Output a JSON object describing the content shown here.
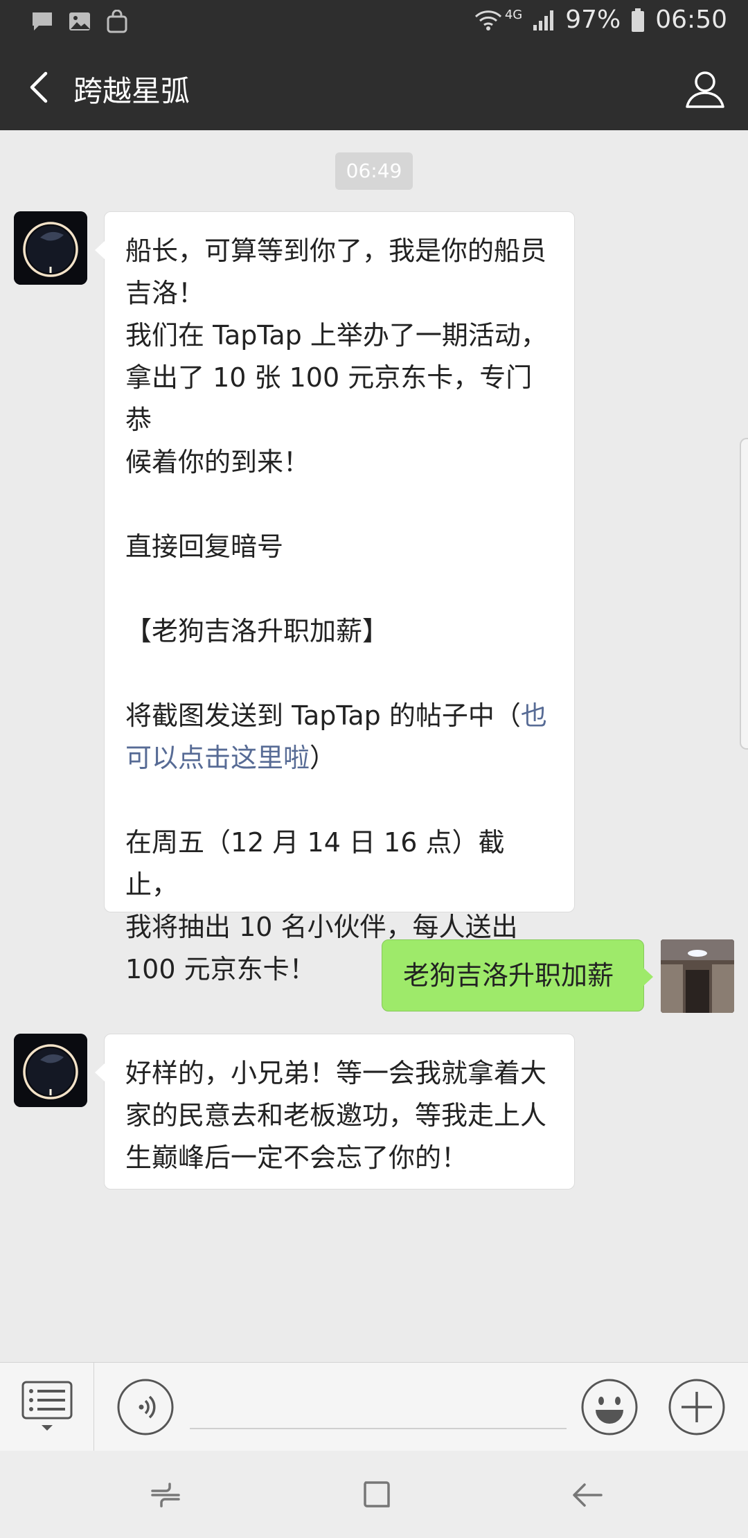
{
  "status_bar": {
    "battery": "97%",
    "time": "06:50",
    "network": "4G",
    "icons": [
      "message-icon",
      "image-icon",
      "bag-icon",
      "wifi-icon",
      "signal-icon",
      "battery-icon"
    ]
  },
  "app_bar": {
    "title": "跨越星弧",
    "back_icon": "chevron-left-icon",
    "profile_icon": "person-icon"
  },
  "chat": {
    "timestamp": "06:49",
    "messages": [
      {
        "side": "left",
        "parts": [
          {
            "text": "船长，可算等到你了，我是你的船员\n吉洛！\n我们在 TapTap 上举办了一期活动，\n拿出了 10 张 100 元京东卡，专门恭\n候着你的到来！\n\n直接回复暗号\n\n【老狗吉洛升职加薪】\n\n将截图发送到 TapTap 的帖子中（",
            "link": false
          },
          {
            "text": "也\n可以点击这里啦",
            "link": true
          },
          {
            "text": "）\n\n在周五（12 月 14 日 16 点）截止，\n我将抽出 10 名小伙伴，每人送出\n100 元京东卡！",
            "link": false
          }
        ]
      },
      {
        "side": "right",
        "text": "老狗吉洛升职加薪"
      },
      {
        "side": "left",
        "text": "好样的，小兄弟！等一会我就拿着大\n家的民意去和老板邀功，等我走上人\n生巅峰后一定不会忘了你的！"
      }
    ]
  },
  "input_bar": {
    "menu_icon": "keyboard-menu-icon",
    "voice_icon": "voice-icon",
    "placeholder": "",
    "emoji_icon": "emoji-icon",
    "plus_icon": "plus-icon"
  },
  "nav_bar": {
    "icons": [
      "recent-apps-icon",
      "home-icon",
      "back-arrow-icon"
    ]
  },
  "colors": {
    "bar": "#2e2e2e",
    "chat_bg": "#ebebeb",
    "own_bubble": "#9eea6a",
    "link": "#576b95"
  }
}
